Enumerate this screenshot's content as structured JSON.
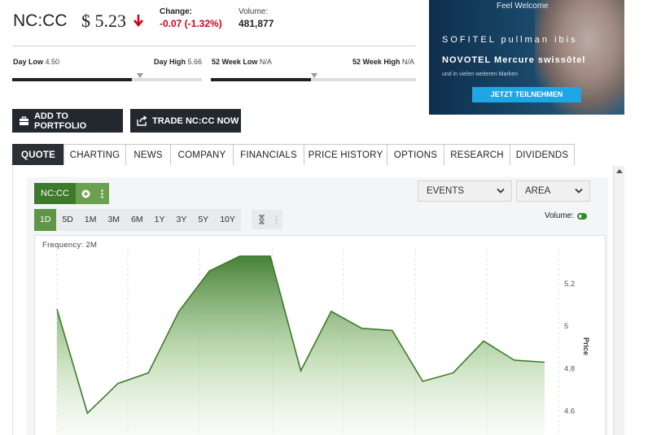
{
  "quote": {
    "symbol": "NC:CC",
    "price": "$ 5.23",
    "change_label": "Change:",
    "change_value": "-0.07 (-1.32%)",
    "volume_label": "Volume:",
    "volume_value": "481,877",
    "down_color": "#d0021b"
  },
  "ranges": {
    "day_low_label": "Day Low",
    "day_low_value": "4.50",
    "day_high_label": "Day High",
    "day_high_value": "5.66",
    "week52_low_label": "52 Week Low",
    "week52_low_value": "N/A",
    "week52_high_label": "52 Week High",
    "week52_high_value": "N/A",
    "day_position": 0.63,
    "week52_position": 0.49
  },
  "ad": {
    "headline": "Feel Welcome",
    "brands_line1": "SOFITEL pullman ibis",
    "brands_line2": "NOVOTEL Mercure swissôtel",
    "subtext": "und in vielen weiteren Marken",
    "cta": "JETZT TEILNEHMEN"
  },
  "actions": {
    "add_portfolio": "ADD TO PORTFOLIO",
    "trade": "TRADE NC:CC NOW"
  },
  "tabs": [
    "QUOTE",
    "CHARTING",
    "NEWS",
    "COMPANY",
    "FINANCIALS",
    "PRICE HISTORY",
    "OPTIONS",
    "RESEARCH",
    "DIVIDENDS"
  ],
  "chart_controls": {
    "symbol_chip": "NC:CC",
    "events_label": "EVENTS",
    "area_label": "AREA",
    "time_ranges": [
      "1D",
      "5D",
      "1M",
      "3M",
      "6M",
      "1Y",
      "3Y",
      "5Y",
      "10Y"
    ],
    "active_range": "1D",
    "volume_label": "Volume:",
    "frequency_label": "Frequency: 2M",
    "accent_color": "#3d7a2c"
  },
  "chart_data": {
    "type": "area",
    "xlabel": "",
    "ylabel": "Price",
    "ylim": [
      4.56,
      5.33
    ],
    "yticks": [
      "5.2",
      "5",
      "4.8",
      "4.6"
    ],
    "ytick_values": [
      5.2,
      5.0,
      4.8,
      4.6
    ],
    "grid": true,
    "series": [
      {
        "values": [
          5.08,
          4.59,
          4.73,
          4.78,
          5.07,
          5.26,
          5.33,
          5.33,
          4.79,
          5.07,
          4.99,
          4.98,
          4.74,
          4.78,
          4.93,
          4.84,
          4.83
        ],
        "x_index": [
          0,
          1,
          2,
          3,
          4,
          5,
          6,
          7,
          8,
          9,
          10,
          11,
          12,
          13,
          14,
          15,
          16
        ]
      }
    ]
  }
}
